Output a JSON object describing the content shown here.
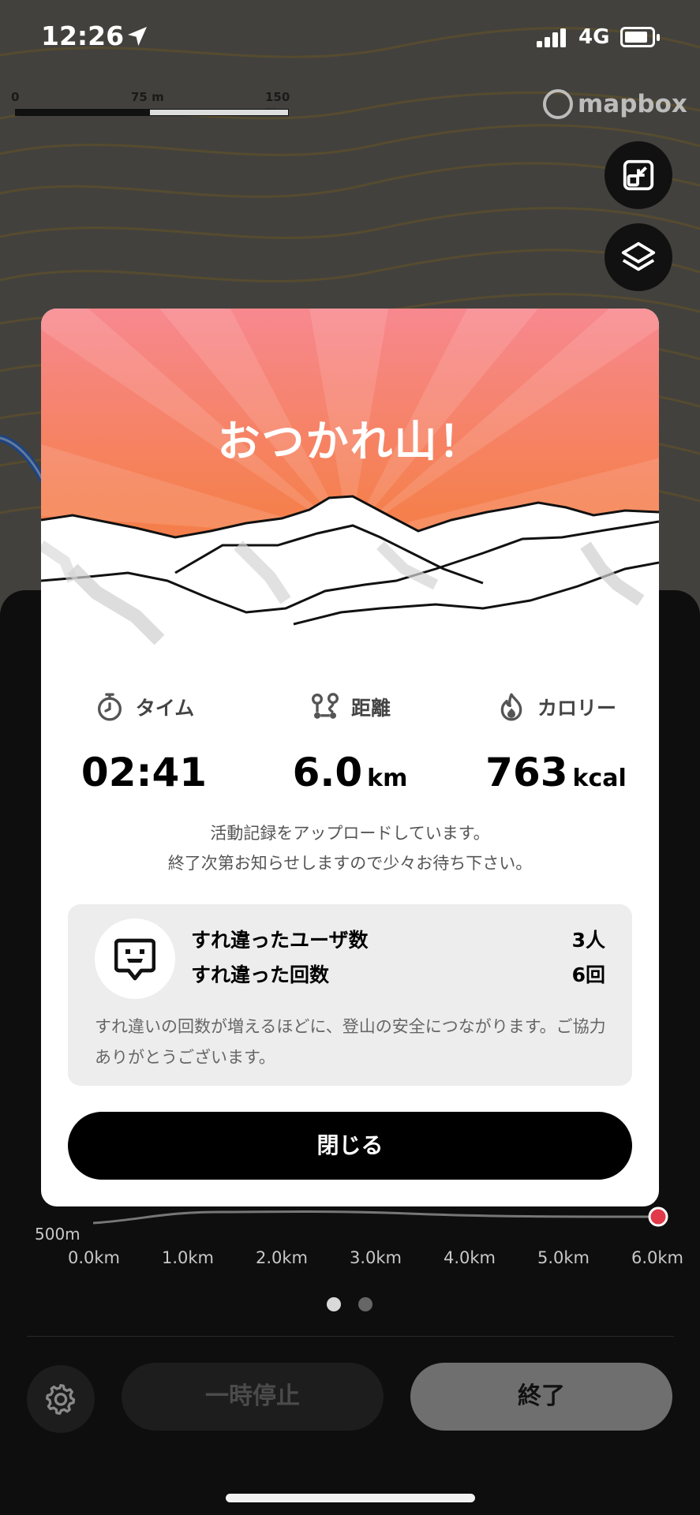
{
  "status_bar": {
    "time": "12:26",
    "network": "4G"
  },
  "map": {
    "scale_labels": [
      "0",
      "75 m",
      "150 m"
    ],
    "attribution": "mapbox"
  },
  "colors": {
    "accent_orange": "#f47a3c",
    "hero_pink": "#f6858a",
    "elevation_dot": "#e0394a",
    "button_dark": "#000000"
  },
  "modal": {
    "title": "おつかれ山！",
    "stats": [
      {
        "icon": "stopwatch-icon",
        "label": "タイム",
        "value": "02:41",
        "unit": ""
      },
      {
        "icon": "route-icon",
        "label": "距離",
        "value": "6.0",
        "unit": "km"
      },
      {
        "icon": "flame-icon",
        "label": "カロリー",
        "value": "763",
        "unit": "kcal"
      }
    ],
    "upload_message_line1": "活動記録をアップロードしています。",
    "upload_message_line2": "終了次第お知らせしますので少々お待ち下さい。",
    "encounter": {
      "icon": "encounter-face-icon",
      "users_label": "すれ違ったユーザ数",
      "users_value": "3人",
      "count_label": "すれ違った回数",
      "count_value": "6回",
      "note": "すれ違いの回数が増えるほどに、登山の安全につながります。ご協力ありがとうございます。"
    },
    "close_label": "閉じる"
  },
  "elevation": {
    "y_label": "500m",
    "x_ticks": [
      "0.0km",
      "1.0km",
      "2.0km",
      "3.0km",
      "4.0km",
      "5.0km",
      "6.0km"
    ]
  },
  "pager": {
    "count": 2,
    "active_index": 0
  },
  "controls": {
    "settings_icon": "gear-icon",
    "pause_label": "一時停止",
    "end_label": "終了"
  }
}
